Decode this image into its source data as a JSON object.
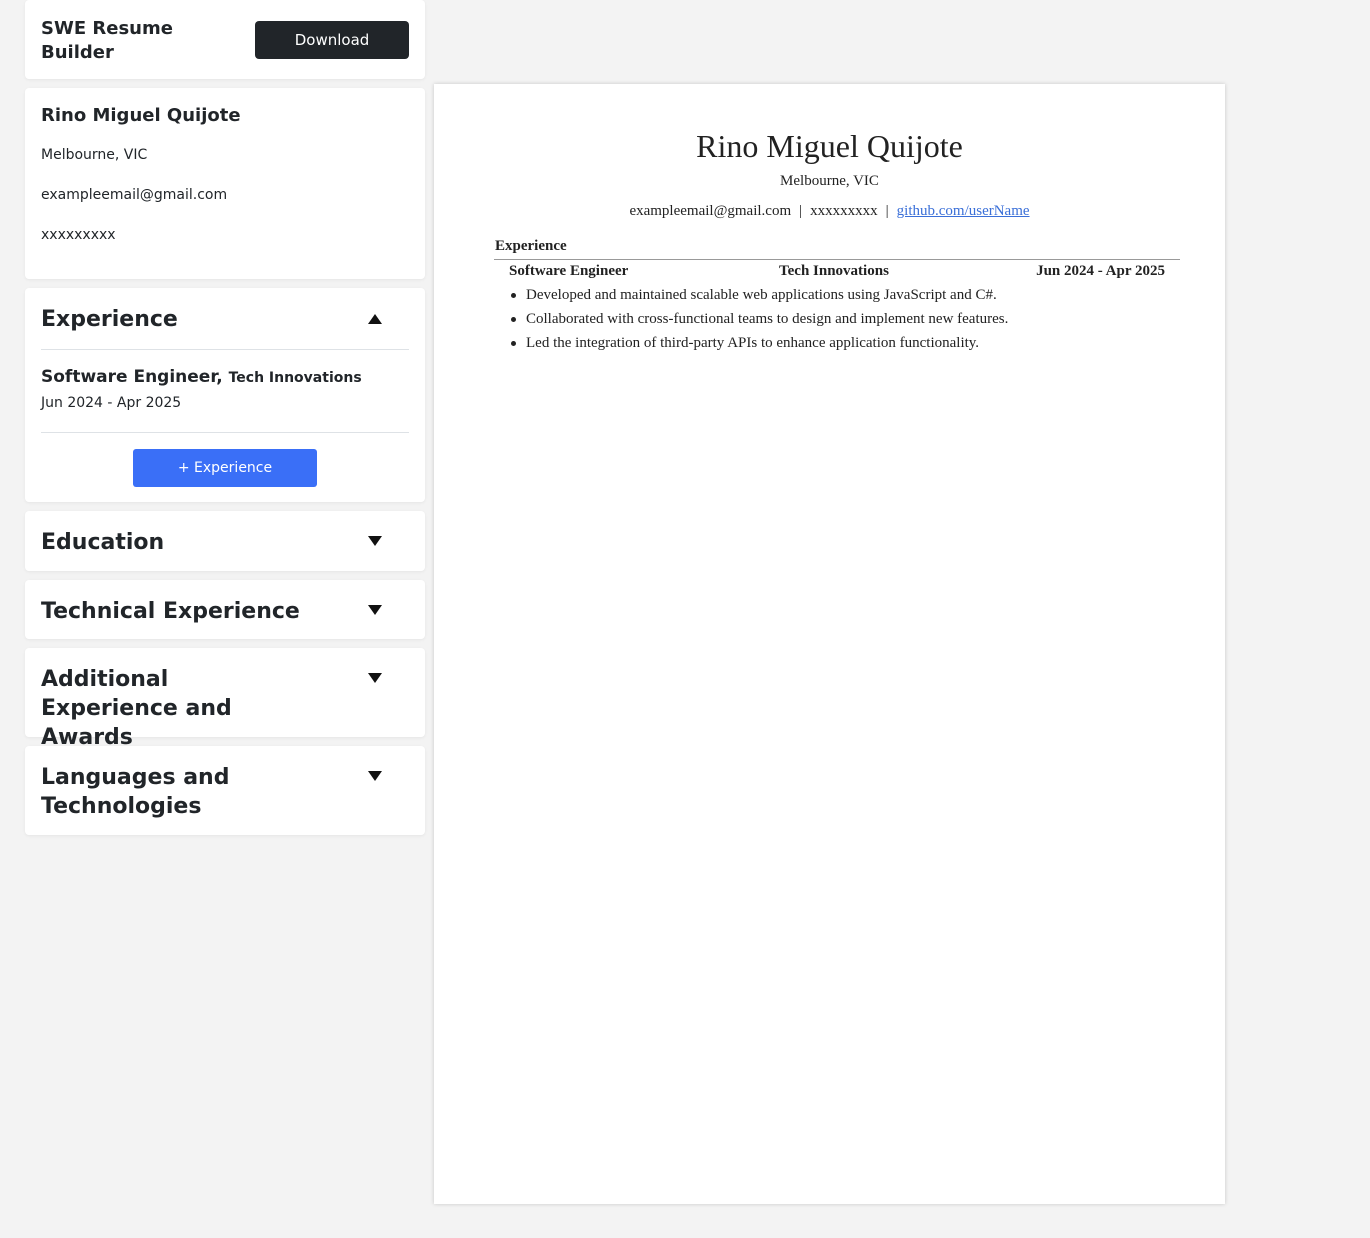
{
  "app": {
    "title": "SWE Resume Builder",
    "download_label": "Download"
  },
  "personal": {
    "name": "Rino Miguel Quijote",
    "location": "Melbourne, VIC",
    "email": "exampleemail@gmail.com",
    "phone": "xxxxxxxxx"
  },
  "sections": {
    "experience": {
      "title": "Experience",
      "expanded": true,
      "toggle_icon": "triangle-up-icon",
      "items": [
        {
          "role": "Software Engineer,",
          "company": "Tech Innovations",
          "dates": "Jun 2024 - Apr 2025"
        }
      ],
      "add_label": "+ Experience"
    },
    "education": {
      "title": "Education",
      "expanded": false,
      "toggle_icon": "triangle-down-icon"
    },
    "technical": {
      "title": "Technical Experience",
      "expanded": false,
      "toggle_icon": "triangle-down-icon"
    },
    "additional": {
      "title": "Additional Experience and Awards",
      "expanded": false,
      "toggle_icon": "triangle-down-icon"
    },
    "languages": {
      "title": "Languages and Technologies",
      "expanded": false,
      "toggle_icon": "triangle-down-icon"
    }
  },
  "resume": {
    "name": "Rino Miguel Quijote",
    "location": "Melbourne, VIC",
    "email": "exampleemail@gmail.com",
    "separator": "|",
    "phone": "xxxxxxxxx",
    "github": "github.com/userName",
    "experience_heading": "Experience",
    "jobs": [
      {
        "title": "Software Engineer",
        "company": "Tech Innovations",
        "dates": "Jun 2024 - Apr 2025",
        "bullets": [
          "Developed and maintained scalable web applications using JavaScript and C#.",
          "Collaborated with cross-functional teams to design and implement new features.",
          "Led the integration of third-party APIs to enhance application functionality."
        ]
      }
    ]
  },
  "colors": {
    "page_bg": "#f3f3f3",
    "download_button": "#212529",
    "add_button": "#3a6ff7",
    "link": "#3a6fd8"
  }
}
